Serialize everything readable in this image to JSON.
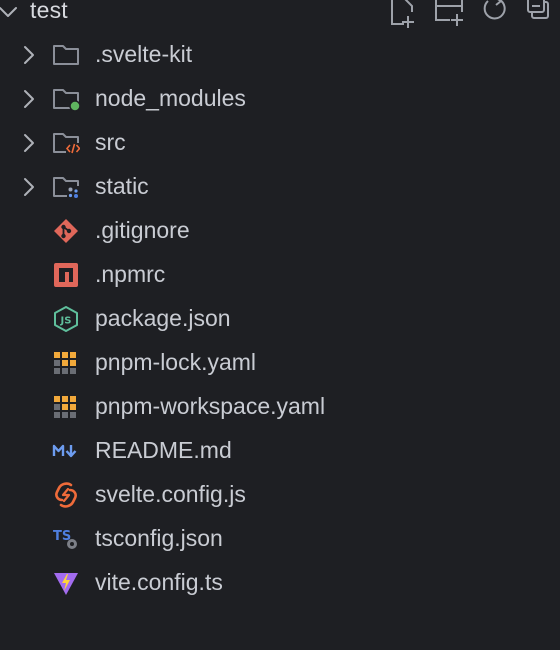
{
  "explorer": {
    "title": "test",
    "actions": [
      {
        "name": "new-file-icon"
      },
      {
        "name": "new-folder-icon"
      },
      {
        "name": "refresh-icon"
      },
      {
        "name": "collapse-all-icon"
      }
    ]
  },
  "tree": [
    {
      "label": ".svelte-kit",
      "type": "folder",
      "icon": "folder-icon"
    },
    {
      "label": "node_modules",
      "type": "folder",
      "icon": "folder-node-icon"
    },
    {
      "label": "src",
      "type": "folder",
      "icon": "folder-src-icon"
    },
    {
      "label": "static",
      "type": "folder",
      "icon": "folder-static-icon"
    },
    {
      "label": ".gitignore",
      "type": "file",
      "icon": "git-icon"
    },
    {
      "label": ".npmrc",
      "type": "file",
      "icon": "npm-icon"
    },
    {
      "label": "package.json",
      "type": "file",
      "icon": "nodejs-icon"
    },
    {
      "label": "pnpm-lock.yaml",
      "type": "file",
      "icon": "pnpm-icon"
    },
    {
      "label": "pnpm-workspace.yaml",
      "type": "file",
      "icon": "pnpm-icon"
    },
    {
      "label": "README.md",
      "type": "file",
      "icon": "markdown-icon"
    },
    {
      "label": "svelte.config.js",
      "type": "file",
      "icon": "svelte-icon"
    },
    {
      "label": "tsconfig.json",
      "type": "file",
      "icon": "tsconfig-icon"
    },
    {
      "label": "vite.config.ts",
      "type": "file",
      "icon": "vite-icon"
    }
  ],
  "colors": {
    "background": "#1e1f23",
    "text": "#c9ccd3",
    "icon_stroke": "#8b8f99",
    "node_dot": "#5fb55f",
    "git": "#e0675a",
    "npm": "#e0675a",
    "nodejs": "#5fbf9c",
    "pnpm": "#f2a93b",
    "markdown": "#6d9cf0",
    "svelte": "#ef6b3a",
    "ts": "#4f7fe0",
    "vite_purple": "#a36cf0",
    "vite_yellow": "#ffd43b"
  }
}
